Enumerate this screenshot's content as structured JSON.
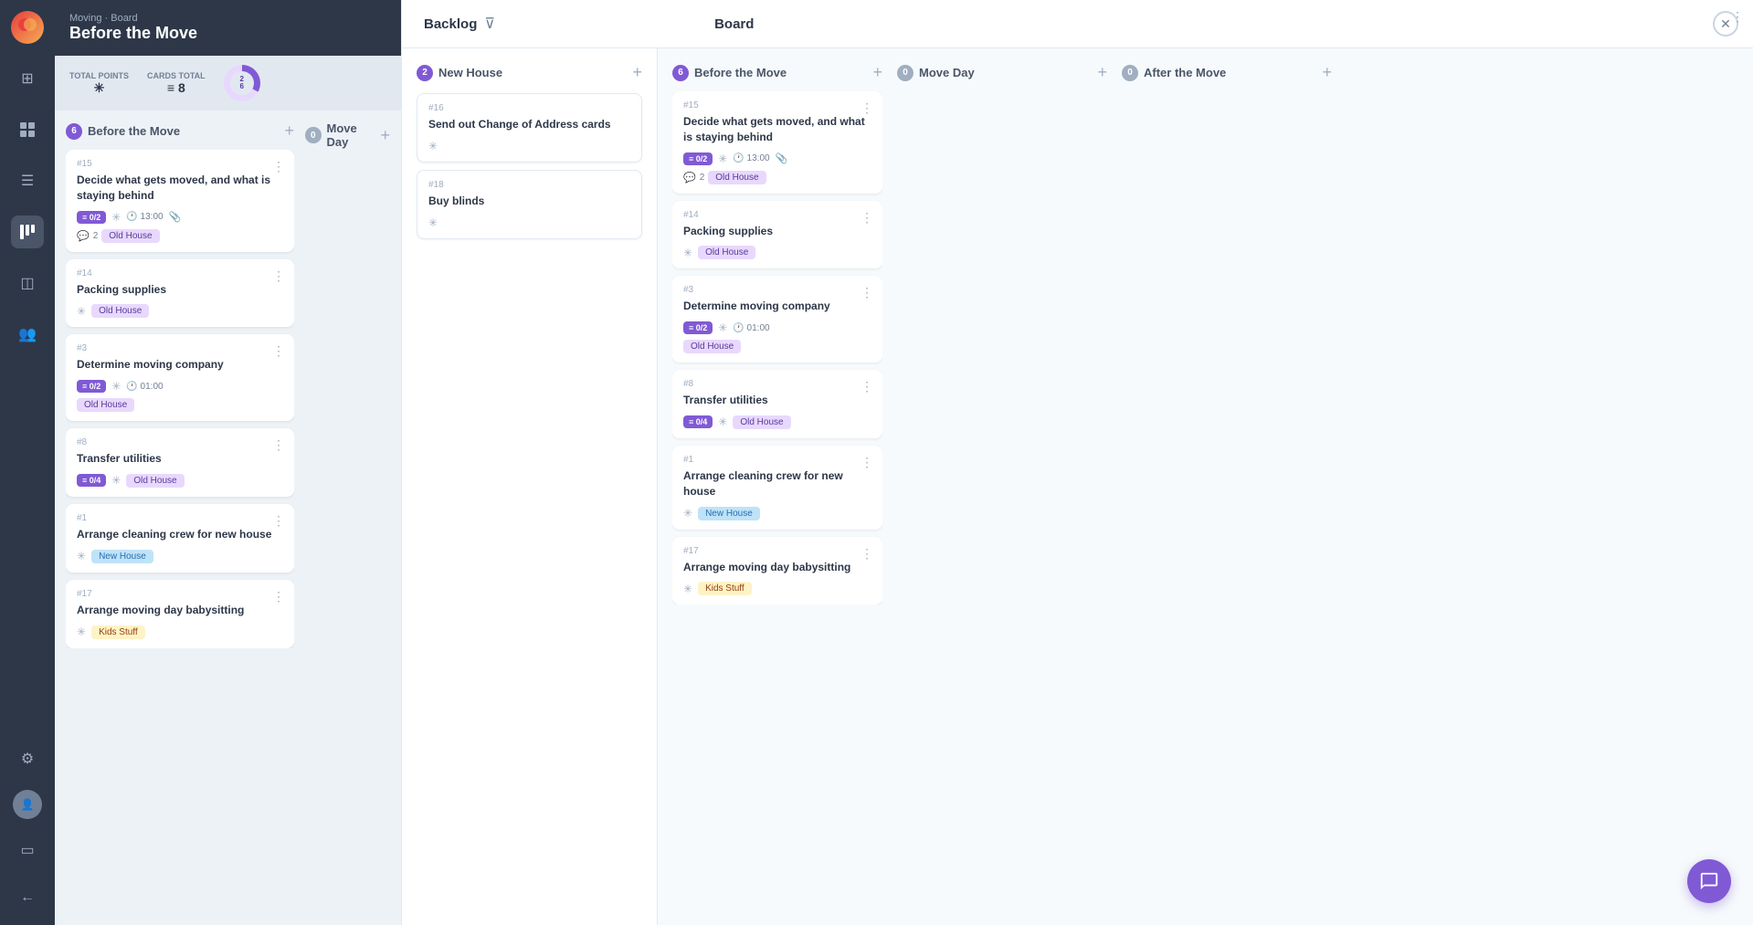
{
  "app": {
    "logo": "M",
    "project_label": "Moving · Board",
    "project_title": "Before the Move"
  },
  "sidebar": {
    "icons": [
      {
        "name": "grid-icon",
        "symbol": "⊞",
        "active": false
      },
      {
        "name": "chart-icon",
        "symbol": "▤",
        "active": false
      },
      {
        "name": "menu-icon",
        "symbol": "☰",
        "active": false
      },
      {
        "name": "board-icon",
        "symbol": "⊡",
        "active": true
      },
      {
        "name": "layers-icon",
        "symbol": "◫",
        "active": false
      },
      {
        "name": "users-icon",
        "symbol": "👥",
        "active": false
      }
    ]
  },
  "stats": {
    "total_points_label": "TOTAL POINTS",
    "total_points_icon": "✳",
    "cards_total_label": "CARDS TOTAL",
    "cards_total_icon": "≡",
    "cards_count": "8",
    "donut_top": "2",
    "donut_bottom": "6"
  },
  "left_board": {
    "columns": [
      {
        "name": "Before the Move",
        "count": "6",
        "count_color": "purple",
        "cards": [
          {
            "id": "#15",
            "title": "Decide what gets moved, and what is staying behind",
            "badge": "0/2",
            "has_star": true,
            "time": "13:00",
            "has_attach": true,
            "comments": "2",
            "tag": "Old House",
            "tag_type": "default"
          },
          {
            "id": "#14",
            "title": "Packing supplies",
            "has_star": true,
            "tag": "Old House",
            "tag_type": "default"
          },
          {
            "id": "#3",
            "title": "Determine moving company",
            "badge": "0/2",
            "has_star": true,
            "time": "01:00",
            "tag": "Old House",
            "tag_type": "default"
          },
          {
            "id": "#8",
            "title": "Transfer utilities",
            "badge": "0/4",
            "has_star": true,
            "tag": "Old House",
            "tag_type": "default"
          },
          {
            "id": "#1",
            "title": "Arrange cleaning crew for new house",
            "has_star": true,
            "tag": "New House",
            "tag_type": "new"
          },
          {
            "id": "#17",
            "title": "Arrange moving day babysitting",
            "has_star": true,
            "tag": "Kids Stuff",
            "tag_type": "kids"
          }
        ]
      },
      {
        "name": "Move Day",
        "count": "0",
        "count_color": "grey",
        "cards": []
      }
    ]
  },
  "overlay": {
    "close_symbol": "✕",
    "backlog": {
      "title": "Backlog",
      "filter_symbol": "⊽",
      "column": {
        "name": "New House",
        "count": "2",
        "cards": [
          {
            "id": "#16",
            "title": "Send out Change of Address cards",
            "has_star": true
          },
          {
            "id": "#18",
            "title": "Buy blinds",
            "has_star": true
          }
        ]
      }
    },
    "board": {
      "title": "Board",
      "columns": [
        {
          "name": "Before the Move",
          "count": "6",
          "count_color": "purple",
          "cards": [
            {
              "id": "#15",
              "title": "Decide what gets moved, and what is staying behind",
              "badge": "0/2",
              "has_star": true,
              "time": "13:00",
              "has_attach": true,
              "comments": "2",
              "tag": "Old House",
              "tag_type": "default"
            },
            {
              "id": "#14",
              "title": "Packing supplies",
              "has_star": true,
              "tag": "Old House",
              "tag_type": "default"
            },
            {
              "id": "#3",
              "title": "Determine moving company",
              "badge": "0/2",
              "has_star": true,
              "time": "01:00",
              "tag": "Old House",
              "tag_type": "default"
            },
            {
              "id": "#8",
              "title": "Transfer utilities",
              "badge": "0/4",
              "has_star": true,
              "tag": "Old House",
              "tag_type": "default"
            },
            {
              "id": "#1",
              "title": "Arrange cleaning crew for new house",
              "has_star": true,
              "tag": "New House",
              "tag_type": "new"
            },
            {
              "id": "#17",
              "title": "Arrange moving day babysitting",
              "has_star": true,
              "tag": "Kids Stuff",
              "tag_type": "kids"
            }
          ]
        },
        {
          "name": "Move Day",
          "count": "0",
          "count_color": "grey",
          "cards": []
        },
        {
          "name": "After the Move",
          "count": "0",
          "count_color": "grey",
          "cards": []
        }
      ]
    }
  },
  "chat": {
    "symbol": "💬"
  }
}
